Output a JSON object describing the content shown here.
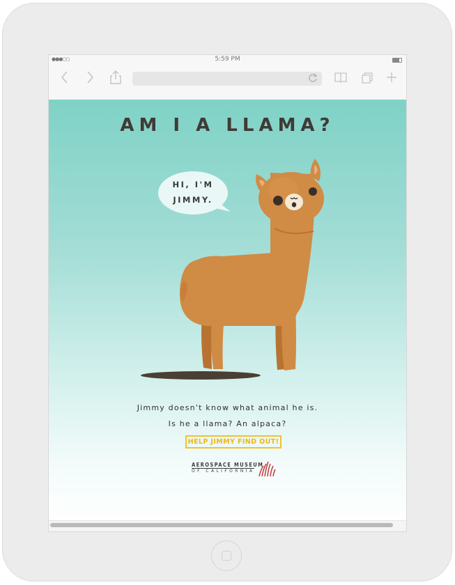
{
  "status_bar": {
    "signal": "●●●○○",
    "time": "5:59 PM"
  },
  "browser": {
    "icons": {
      "back": "chevron-left-icon",
      "forward": "chevron-right-icon",
      "share": "share-icon",
      "reload": "reload-icon",
      "bookmarks": "book-icon",
      "tabs": "tabs-icon",
      "new_tab": "plus-icon"
    },
    "url": ""
  },
  "page": {
    "headline": "AM I A LLAMA?",
    "bubble_line1": "HI, I'M",
    "bubble_line2": "JIMMY.",
    "body_line1": "Jimmy doesn't know what animal he is.",
    "body_line2": "Is he a llama? An alpaca?",
    "cta_label": "HELP JIMMY FIND OUT!",
    "logo_line1": "AEROSPACE MUSEUM",
    "logo_line2": "OF CALIFORNIA"
  },
  "colors": {
    "teal_top": "#7fd2c6",
    "llama_body": "#d08b45",
    "llama_shadow": "#b87332",
    "headline_text": "#403a35",
    "cta_accent": "#f4c12c",
    "logo_mark": "#c23a3a"
  }
}
